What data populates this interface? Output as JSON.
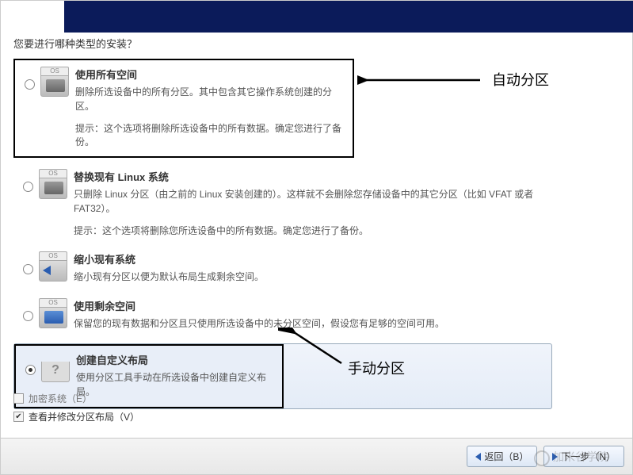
{
  "prompt": "您要进行哪种类型的安装？",
  "options": [
    {
      "title": "使用所有空间",
      "desc": "删除所选设备中的所有分区。其中包含其它操作系统创建的分区。",
      "hint": "提示：这个选项将删除所选设备中的所有数据。确定您进行了备份。"
    },
    {
      "title": "替换现有 Linux 系统",
      "desc": "只删除 Linux 分区（由之前的 Linux 安装创建的）。这样就不会删除您存储设备中的其它分区（比如 VFAT 或者 FAT32）。",
      "hint": "提示：这个选项将删除您所选设备中的所有数据。确定您进行了备份。"
    },
    {
      "title": "缩小现有系统",
      "desc": "缩小现有分区以便为默认布局生成剩余空间。",
      "hint": ""
    },
    {
      "title": "使用剩余空间",
      "desc": "保留您的现有数据和分区且只使用所选设备中的未分区空间，假设您有足够的空间可用。",
      "hint": ""
    },
    {
      "title": "创建自定义布局",
      "desc": "使用分区工具手动在所选设备中创建自定义布局。",
      "hint": ""
    }
  ],
  "checkboxes": {
    "encrypt": "加密系统（E）",
    "review": "查看并修改分区布局（V）"
  },
  "buttons": {
    "back": "返回（B）",
    "next": "下一步（N）"
  },
  "annotations": {
    "auto": "自动分区",
    "manual": "手动分区"
  },
  "watermark": "加米谷学院",
  "icon_label": "OS"
}
